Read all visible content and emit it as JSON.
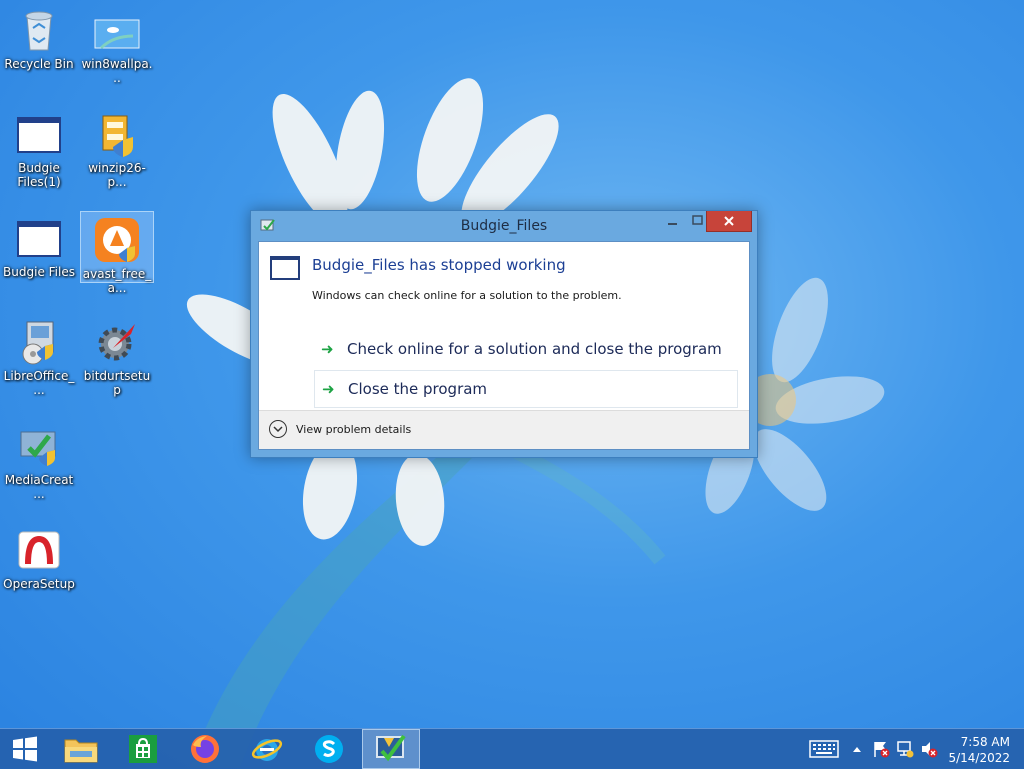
{
  "desktop": {
    "icons": [
      {
        "label": "Recycle Bin",
        "icon": "recycle-bin-icon"
      },
      {
        "label": "win8wallpa...",
        "icon": "image-file-icon"
      },
      {
        "label": "Budgie Files(1)",
        "icon": "app-window-icon"
      },
      {
        "label": "winzip26-p...",
        "icon": "installer-icon"
      },
      {
        "label": "Budgie Files",
        "icon": "app-window-icon"
      },
      {
        "label": "avast_free_a...",
        "icon": "avast-icon"
      },
      {
        "label": "LibreOffice_...",
        "icon": "installer-icon"
      },
      {
        "label": "bitdurtsetup",
        "icon": "gear-icon"
      },
      {
        "label": "MediaCreat...",
        "icon": "media-creation-icon"
      },
      {
        "label": "OperaSetup",
        "icon": "opera-icon"
      }
    ]
  },
  "dialog": {
    "title": "Budgie_Files",
    "heading": "Budgie_Files has stopped working",
    "message": "Windows can check online for a solution to the problem.",
    "commands": [
      {
        "label": "Check online for a solution and close the program"
      },
      {
        "label": "Close the program"
      }
    ],
    "details_label": "View problem details",
    "close_color": "#c7443a"
  },
  "taskbar": {
    "apps": [
      "start-icon",
      "file-explorer-icon",
      "store-icon",
      "firefox-icon",
      "internet-explorer-icon",
      "skype-icon",
      "problem-reporting-icon"
    ],
    "clock_time": "7:58 AM",
    "clock_date": "5/14/2022"
  }
}
